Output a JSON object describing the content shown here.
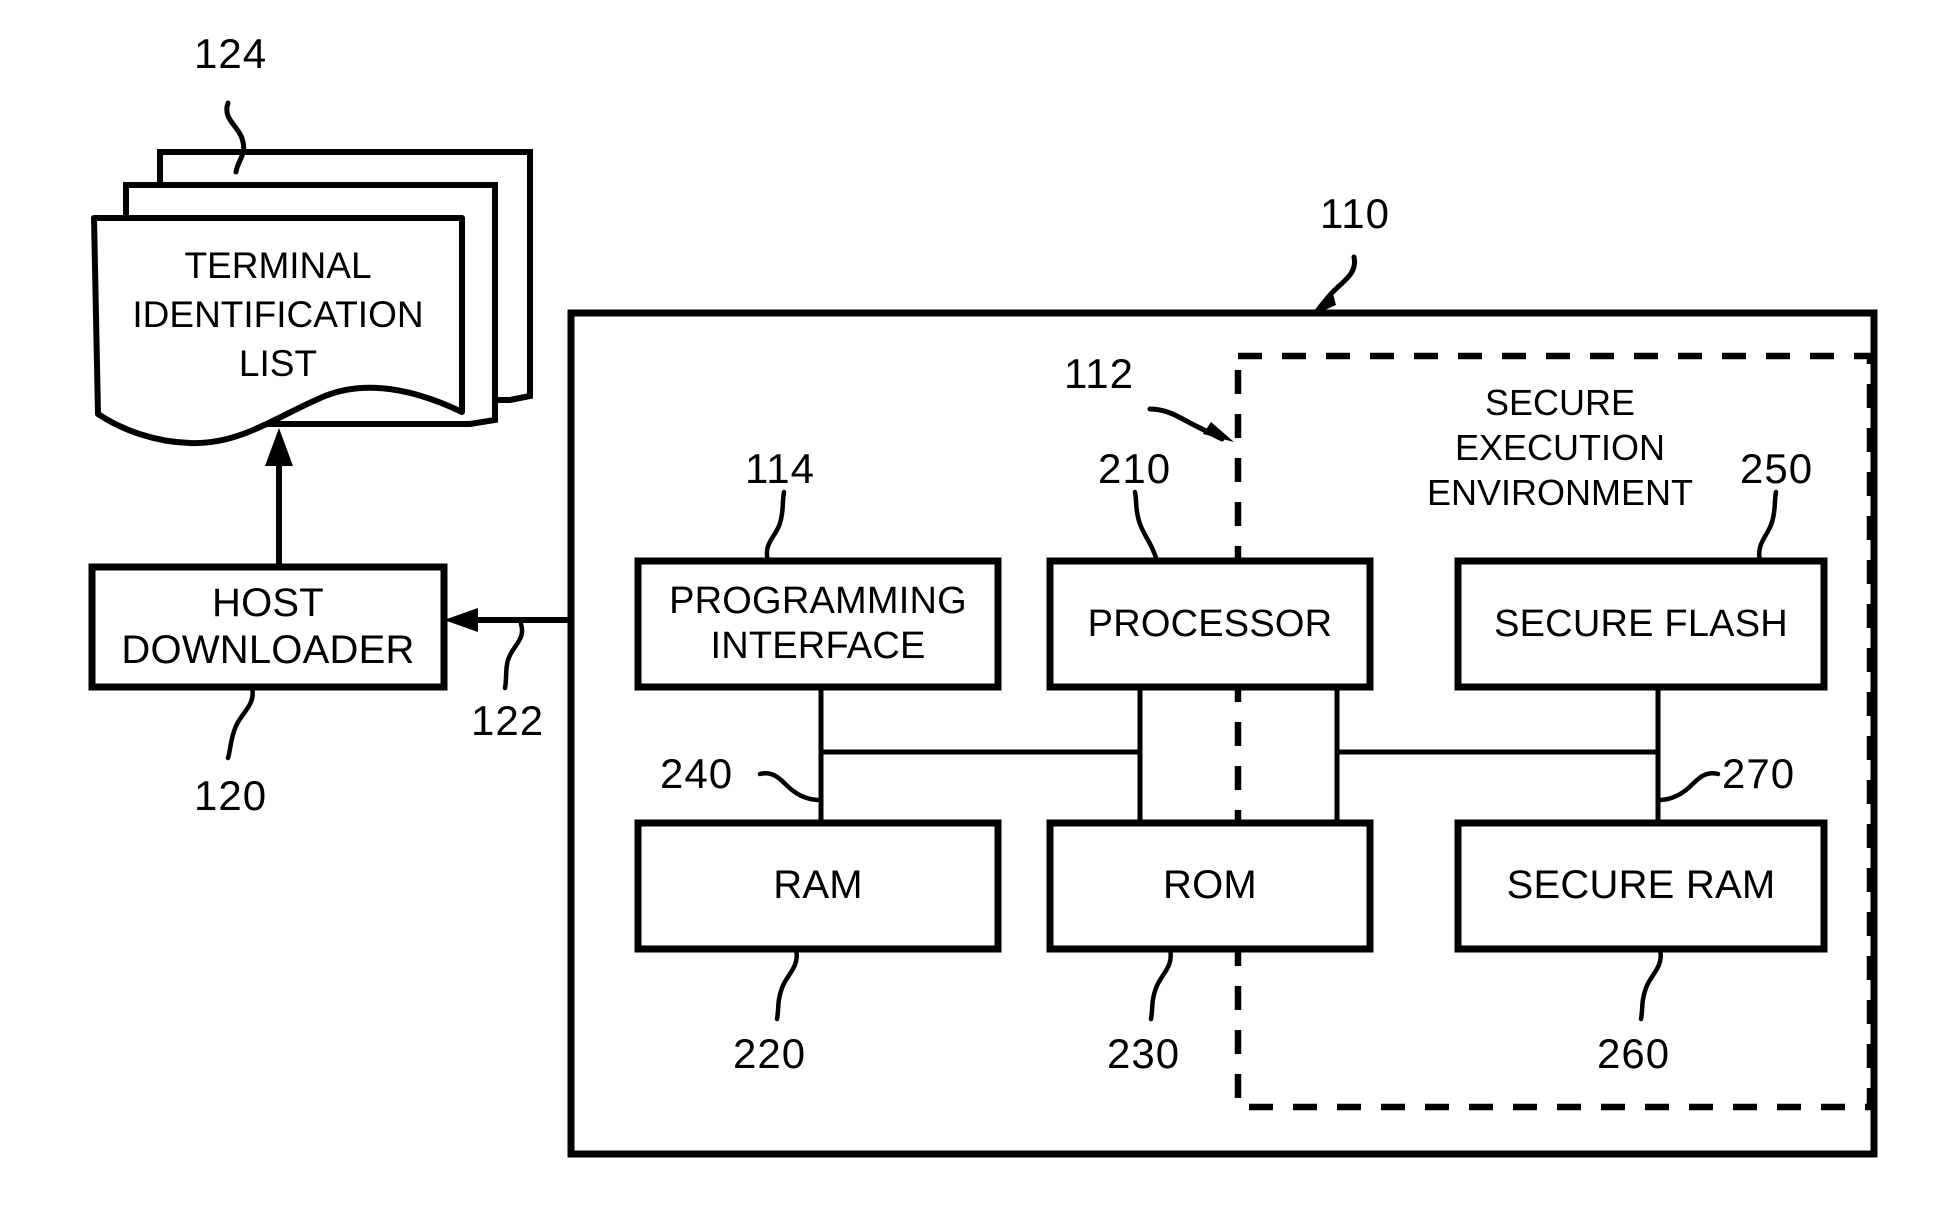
{
  "figure": {
    "type": "patent-block-diagram",
    "background_color": "#ffffff",
    "line_color": "#000000"
  },
  "document_stack": {
    "name": "terminal-identification-list",
    "title": "TERMINAL\nIDENTIFICATION\nLIST",
    "ref": "124"
  },
  "host": {
    "label": "HOST\nDOWNLOADER",
    "ref": "120"
  },
  "link": {
    "ref": "122"
  },
  "chip": {
    "ref": "110"
  },
  "secure_env": {
    "label": "SECURE\nEXECUTION\nENVIRONMENT",
    "ref": "112"
  },
  "blocks": [
    {
      "id": "programming-interface",
      "label": "PROGRAMMING\nINTERFACE",
      "ref": "114",
      "font_size": 38
    },
    {
      "id": "processor",
      "label": "PROCESSOR",
      "ref": "210",
      "font_size": 38
    },
    {
      "id": "secure-flash",
      "label": "SECURE FLASH",
      "ref": "250",
      "font_size": 38
    },
    {
      "id": "ram",
      "label": "RAM",
      "ref": "220",
      "font_size": 40
    },
    {
      "id": "rom",
      "label": "ROM",
      "ref": "230",
      "font_size": 40
    },
    {
      "id": "secure-ram",
      "label": "SECURE RAM",
      "ref": "260",
      "font_size": 40
    }
  ],
  "buses": [
    {
      "id": "bus-left",
      "ref": "240"
    },
    {
      "id": "bus-right",
      "ref": "270"
    }
  ]
}
